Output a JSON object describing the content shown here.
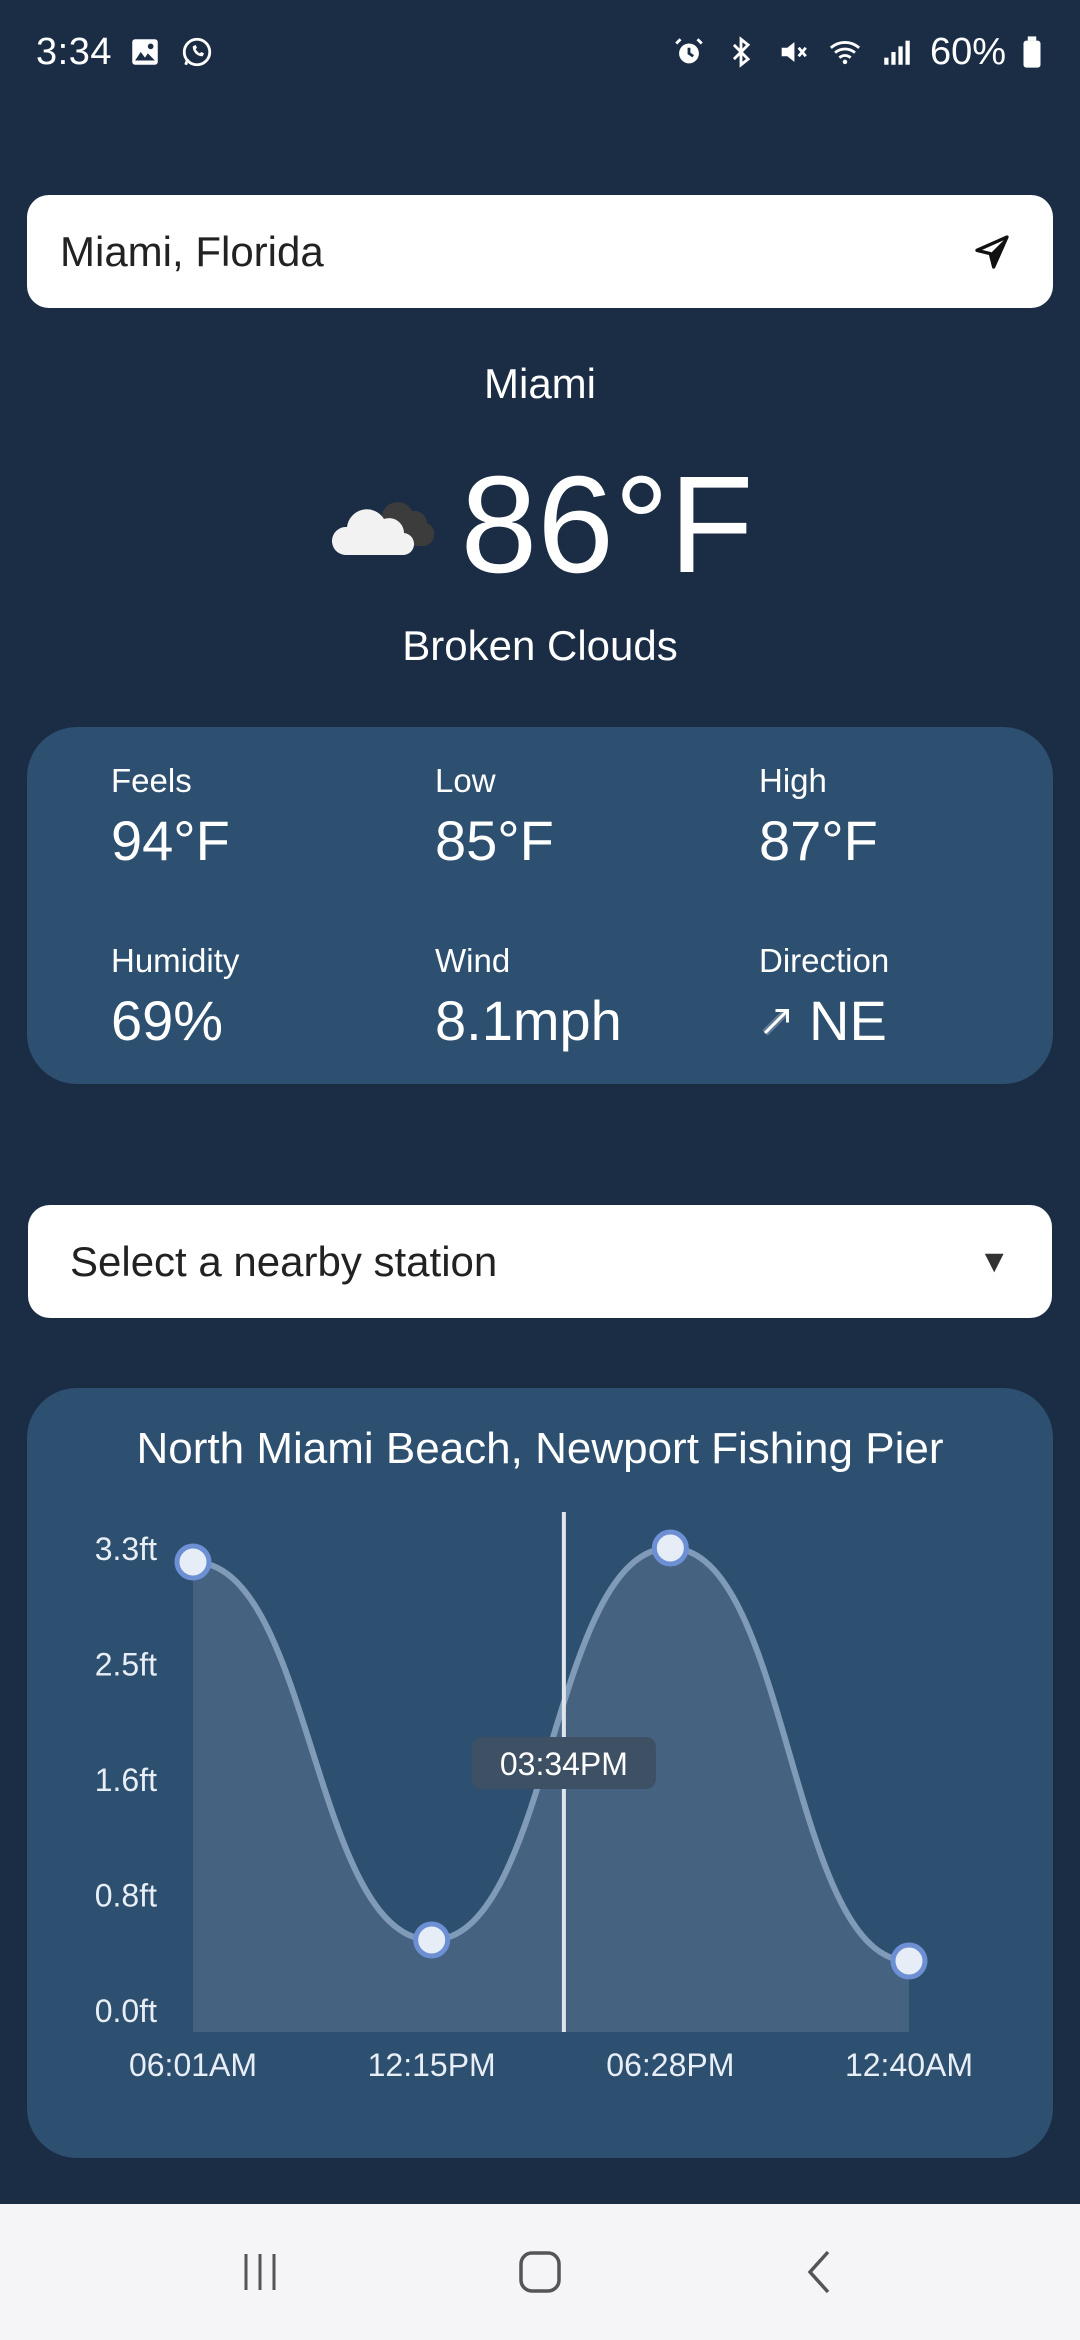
{
  "status_bar": {
    "time": "3:34",
    "battery": "60%"
  },
  "search": {
    "value": "Miami, Florida",
    "placeholder": ""
  },
  "current": {
    "city": "Miami",
    "temperature": "86°F",
    "condition": "Broken Clouds",
    "icon": "broken-clouds-icon"
  },
  "stats": {
    "feels_label": "Feels",
    "feels_value": "94°F",
    "low_label": "Low",
    "low_value": "85°F",
    "high_label": "High",
    "high_value": "87°F",
    "humidity_label": "Humidity",
    "humidity_value": "69%",
    "wind_label": "Wind",
    "wind_value": "8.1mph",
    "direction_label": "Direction",
    "direction_value": "NE"
  },
  "station_select": {
    "selected": "Select a nearby station"
  },
  "tide": {
    "title": "North Miami Beach, Newport Fishing Pier",
    "current_time_label": "03:34PM"
  },
  "chart_data": {
    "type": "area",
    "title": "North Miami Beach, Newport Fishing Pier",
    "xlabel": "",
    "ylabel": "",
    "x_ticks": [
      "06:01AM",
      "12:15PM",
      "06:28PM",
      "12:40AM"
    ],
    "y_ticks": [
      "0.0ft",
      "0.8ft",
      "1.6ft",
      "2.5ft",
      "3.3ft"
    ],
    "ylim": [
      0,
      3.3
    ],
    "points": [
      {
        "time": "06:01AM",
        "value": 3.2
      },
      {
        "time": "12:15PM",
        "value": 0.5
      },
      {
        "time": "06:28PM",
        "value": 3.3
      },
      {
        "time": "12:40AM",
        "value": 0.35
      }
    ],
    "current_time": "03:34PM",
    "current_time_fraction": 0.518,
    "grid": false,
    "colors": {
      "line": "#7f9bb8",
      "fill": "#4a6583",
      "marker_fill": "#e6edf7",
      "marker_stroke": "#6d8fd3",
      "cursor": "#dfe5ec",
      "tooltip_bg": "#3e5064"
    }
  },
  "nav": {
    "recent_icon": "recent-apps-icon",
    "home_icon": "home-icon",
    "back_icon": "back-icon"
  }
}
